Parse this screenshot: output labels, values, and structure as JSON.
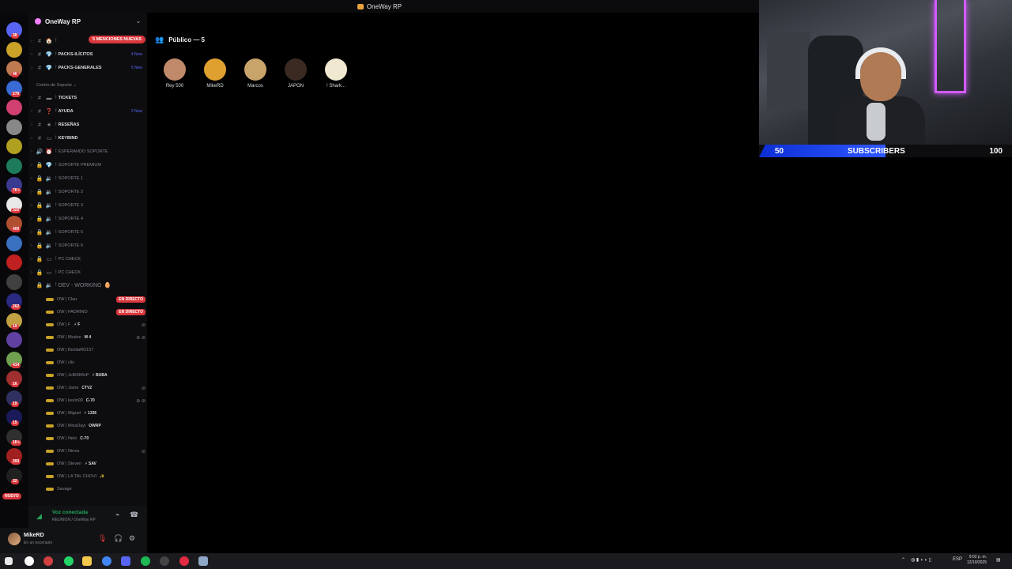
{
  "window": {
    "title": "OneWay RP"
  },
  "server": {
    "name": "OneWay RP"
  },
  "mentions_badge": "5 MENCIONES NUEVAS",
  "channels_top": [
    {
      "icon": "#",
      "emoji": "🏠",
      "label": "",
      "count": ""
    },
    {
      "icon": "#",
      "emoji": "💎",
      "label": "PACKS-ILÍCITOS",
      "count": "4 New"
    },
    {
      "icon": "#",
      "emoji": "💎",
      "label": "PACKS-GENERALES",
      "count": "5 New"
    }
  ],
  "category_support": "Centro de Soporte",
  "channels_support": [
    {
      "icon": "#",
      "emoji": "▬",
      "label": "TICKETS",
      "count": "",
      "dim": false
    },
    {
      "icon": "#",
      "emoji": "❓",
      "label": "AYUDA",
      "count": "2 New",
      "dim": false
    },
    {
      "icon": "#",
      "emoji": "★",
      "label": "RESEÑAS",
      "count": "",
      "dim": false
    },
    {
      "icon": "#",
      "emoji": "▭",
      "label": "KEYBIND",
      "count": "",
      "dim": false
    },
    {
      "icon": "🔊",
      "emoji": "⏰",
      "label": "ESPERANDO SOPORTE",
      "count": "",
      "dim": true
    },
    {
      "icon": "🔒",
      "emoji": "💎",
      "label": "SOPORTE PREMIUM",
      "count": "",
      "dim": true
    },
    {
      "icon": "🔒",
      "emoji": "🔉",
      "label": "SOPORTE 1",
      "count": "",
      "dim": true
    },
    {
      "icon": "🔒",
      "emoji": "🔉",
      "label": "SOPORTE 2",
      "count": "",
      "dim": true
    },
    {
      "icon": "🔒",
      "emoji": "🔉",
      "label": "SOPORTE 3",
      "count": "",
      "dim": true
    },
    {
      "icon": "🔒",
      "emoji": "🔉",
      "label": "SOPORTE 4",
      "count": "",
      "dim": true
    },
    {
      "icon": "🔒",
      "emoji": "🔉",
      "label": "SOPORTE 5",
      "count": "",
      "dim": true
    },
    {
      "icon": "🔒",
      "emoji": "🔉",
      "label": "SOPORTE 6",
      "count": "",
      "dim": true
    },
    {
      "icon": "🔒",
      "emoji": "▭",
      "label": "PC CHECK",
      "count": "",
      "dim": true
    },
    {
      "icon": "🔒",
      "emoji": "▭",
      "label": "PC CHECK",
      "count": "",
      "dim": true
    }
  ],
  "voice_channel": {
    "label": "DEV - WORKING"
  },
  "live_label": "EN DIRECTO",
  "voice_users": [
    {
      "name": "OW | Clau",
      "tag": "",
      "live": true,
      "muted": ""
    },
    {
      "name": "OW | PADRINO",
      "tag": "",
      "live": true,
      "muted": ""
    },
    {
      "name": "OW | F",
      "tag": "⚡ F",
      "live": false,
      "muted": "⊘"
    },
    {
      "name": "OW | Mudoo",
      "tag": "M 4",
      "live": false,
      "muted": "⊘ ⊘"
    },
    {
      "name": "OW | BestiaRD157",
      "tag": "",
      "live": false,
      "muted": ""
    },
    {
      "name": "OW | clis",
      "tag": "",
      "live": false,
      "muted": ""
    },
    {
      "name": "OW | JcB09MvP",
      "tag": "⚡ BUBA",
      "live": false,
      "muted": ""
    },
    {
      "name": "OW | Jame",
      "tag": "CTV2",
      "live": false,
      "muted": "⊘"
    },
    {
      "name": "OW | kevin09",
      "tag": "C-70",
      "live": false,
      "muted": "⊘ ⊘"
    },
    {
      "name": "OW | Miguel",
      "tag": "⚡ 1336",
      "live": false,
      "muted": ""
    },
    {
      "name": "OW | MissDayl",
      "tag": "OWRP",
      "live": false,
      "muted": ""
    },
    {
      "name": "OW | Nelo",
      "tag": "C-70",
      "live": false,
      "muted": ""
    },
    {
      "name": "OW | Ninea",
      "tag": "",
      "live": false,
      "muted": "⊘"
    },
    {
      "name": "OW | Steven",
      "tag": "⚡ SAV",
      "live": false,
      "muted": ""
    },
    {
      "name": "OW | LA TAL CHOVI",
      "tag": "✨",
      "live": false,
      "muted": ""
    },
    {
      "name": "Savage",
      "tag": "",
      "live": false,
      "muted": ""
    }
  ],
  "rail": {
    "badges": [
      "38",
      "",
      "46",
      "279",
      "",
      "",
      "",
      "",
      "7K+",
      "320",
      "400",
      "",
      "",
      "",
      "262",
      "19",
      "",
      "414",
      "16",
      "19",
      "15",
      "1K+",
      "393",
      "32"
    ],
    "new_label": "NUEVO"
  },
  "voice_panel": {
    "status": "Voz conectada",
    "sub": "REUNION  /  OneWay RP"
  },
  "user_panel": {
    "name": "MikeRD",
    "status": "En un escenario"
  },
  "stage": {
    "header": "Público — 5",
    "users": [
      {
        "name": "Rey 500",
        "color": "#c08a6a"
      },
      {
        "name": "MikeRD",
        "color": "#e0a030"
      },
      {
        "name": "Marcos",
        "color": "#c9a46a"
      },
      {
        "name": "JAPON",
        "color": "#3a2a22"
      },
      {
        "name": "! Shark...",
        "color": "#f0e8d0"
      }
    ]
  },
  "subscribers": {
    "low": "50",
    "label": "SUBSCRIBERS",
    "high": "100",
    "progress": 0.5
  },
  "taskbar": {
    "lang": "ESP",
    "time": "9:02 p. m.",
    "date": "12/10/2025"
  },
  "colors": {
    "accent": "#5865f2",
    "danger": "#da373c",
    "online": "#23a55a",
    "neon": "#d25bff",
    "sub_fill": "#2f56ff"
  }
}
